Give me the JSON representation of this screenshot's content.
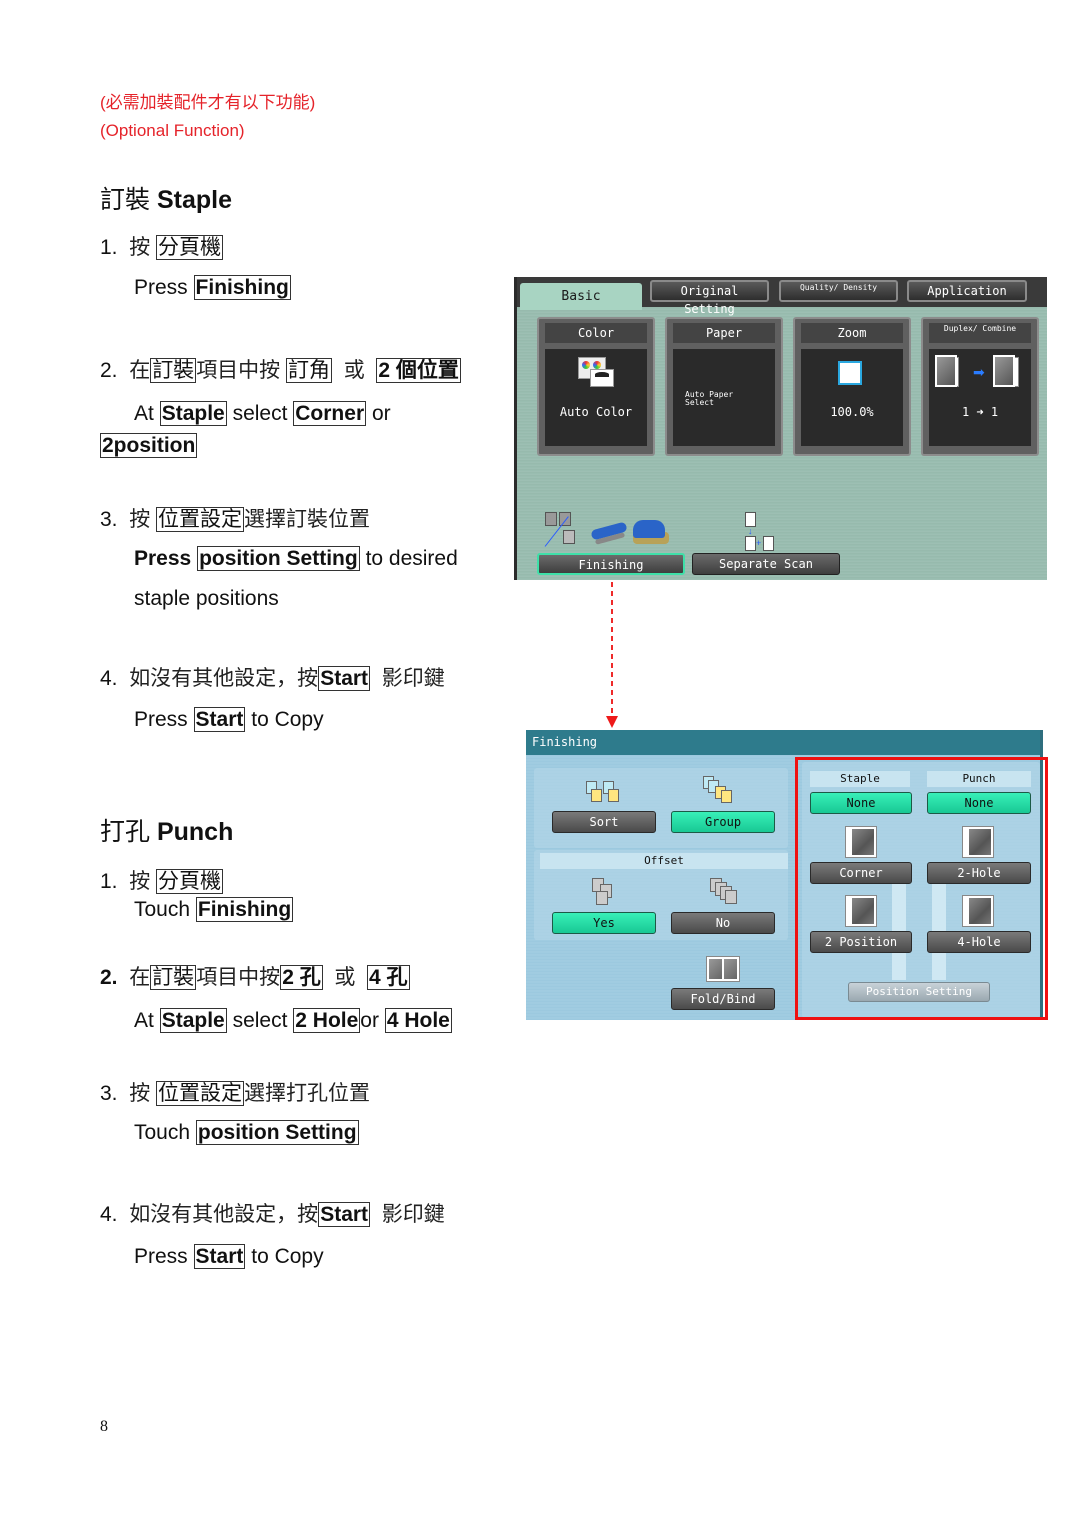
{
  "note": {
    "chinese": "(必需加裝配件才有以下功能)",
    "english": "(Optional Function)"
  },
  "staple": {
    "heading_cjk": "訂裝",
    "heading_en": "Staple",
    "step1": {
      "num": "1.",
      "cjk_pre": "按",
      "cjk_box": "分頁機",
      "en_pre": "Press",
      "en_box": "Finishing"
    },
    "step2": {
      "num": "2.",
      "cjk_pre": "在",
      "cjk_box1": "訂裝",
      "cjk_mid": "項目中按",
      "cjk_box2": "訂角",
      "cjk_or": "或",
      "cjk_box3": "2 個位置",
      "en_at": "At",
      "en_box1": "Staple",
      "en_select": "select",
      "en_box2": "Corner",
      "en_or": "or",
      "en_box3": "2position"
    },
    "step3": {
      "num": "3.",
      "cjk_pre": "按",
      "cjk_box": "位置設定",
      "cjk_post": "選擇訂裝位置",
      "en_pre": "Press",
      "en_box": "position Setting",
      "en_post": "to desired",
      "en_line2": "staple positions"
    },
    "step4": {
      "num": "4.",
      "cjk_pre": "如沒有其他設定，按",
      "cjk_box": "Start",
      "cjk_post": "影印鍵",
      "en_pre": "Press",
      "en_box": "Start",
      "en_post": "to Copy"
    }
  },
  "punch": {
    "heading_cjk": "打孔",
    "heading_en": "Punch",
    "step1": {
      "num": "1.",
      "cjk_pre": "按",
      "cjk_box": "分頁機",
      "en_pre": "Touch",
      "en_box": "Finishing"
    },
    "step2": {
      "num": "2.",
      "cjk_pre": "在",
      "cjk_box1": "訂裝",
      "cjk_mid": "項目中按",
      "cjk_box2": "2 孔",
      "cjk_or": "或",
      "cjk_box3": "4 孔",
      "en_at": "At",
      "en_box1": "Staple",
      "en_select": "select",
      "en_box2": "2 Hole",
      "en_or": "or",
      "en_box3": "4 Hole"
    },
    "step3": {
      "num": "3.",
      "cjk_pre": "按",
      "cjk_box": "位置設定",
      "cjk_post": "選擇打孔位置",
      "en_pre": "Touch",
      "en_box": "position Setting"
    },
    "step4": {
      "num": "4.",
      "cjk_pre": "如沒有其他設定，按",
      "cjk_box": "Start",
      "cjk_post": "影印鍵",
      "en_pre": "Press",
      "en_box": "Start",
      "en_post": "to Copy"
    }
  },
  "basic_screen": {
    "tabs": [
      "Basic",
      "Original Setting",
      "Quality/ Density",
      "Application"
    ],
    "cards": [
      {
        "title": "Color",
        "value": "Auto Color"
      },
      {
        "title": "Paper",
        "value": "Auto Paper Select"
      },
      {
        "title": "Zoom",
        "value": "100.0%"
      },
      {
        "title": "Duplex/ Combine",
        "value": "1 ➜ 1"
      }
    ],
    "buttons": {
      "finishing": "Finishing",
      "separate_scan": "Separate Scan"
    }
  },
  "finishing_screen": {
    "title": "Finishing",
    "sort": "Sort",
    "group": "Group",
    "offset_label": "Offset",
    "offset_yes": "Yes",
    "offset_no": "No",
    "fold_bind": "Fold/Bind",
    "staple_label": "Staple",
    "punch_label": "Punch",
    "staple_none": "None",
    "punch_none": "None",
    "corner": "Corner",
    "two_hole": "2-Hole",
    "two_position": "2 Position",
    "four_hole": "4-Hole",
    "position_setting": "Position Setting"
  },
  "colors": {
    "note_red": "#e5232a",
    "highlight_frame": "#ee1111",
    "active_green": "#22dca6",
    "screen_header": "#2e7b8c"
  },
  "page_number": "8"
}
